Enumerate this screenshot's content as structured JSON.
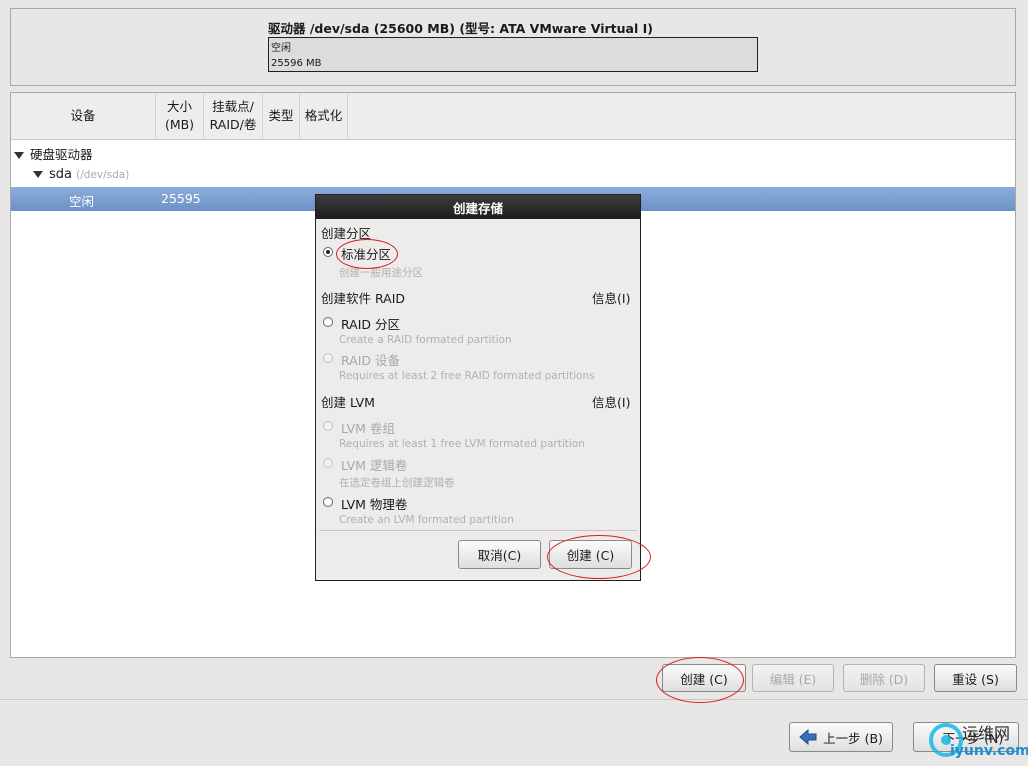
{
  "drive": {
    "title": "驱动器 /dev/sda (25600 MB) (型号: ATA VMware Virtual I)",
    "free_label": "空闲",
    "free_size": "25596 MB"
  },
  "table": {
    "columns": [
      "设备",
      "大小\n(MB)",
      "挂载点/\nRAID/卷",
      "类型",
      "格式化"
    ],
    "group_label": "硬盘驱动器",
    "disk_name": "sda",
    "disk_path": "(/dev/sda)",
    "free_row": {
      "device": "空闲",
      "size": "25595"
    }
  },
  "dialog": {
    "title": "创建存储",
    "section_partition": "创建分区",
    "standard_partition": "标准分区",
    "standard_partition_hint": "创建一般用途分区",
    "section_raid": "创建软件 RAID",
    "info_link": "信息(I)",
    "raid_partition": "RAID 分区",
    "raid_partition_hint": "Create a RAID formated partition",
    "raid_device": "RAID 设备",
    "raid_device_hint": "Requires at least 2 free RAID formated partitions",
    "section_lvm": "创建 LVM",
    "lvm_vg": "LVM 卷组",
    "lvm_vg_hint": "Requires at least 1 free LVM formated partition",
    "lvm_lv": "LVM 逻辑卷",
    "lvm_lv_hint": "在选定卷组上创建逻辑卷",
    "lvm_pv": "LVM 物理卷",
    "lvm_pv_hint": "Create an LVM formated partition",
    "cancel": "取消(C)",
    "create": "创建 (C)"
  },
  "toolbar": {
    "create": "创建 (C)",
    "edit": "编辑 (E)",
    "delete": "删除 (D)",
    "reset": "重设 (S)"
  },
  "nav": {
    "back": "上一步 (B)",
    "next": "下一步 (N)"
  },
  "watermark": {
    "line1": "运维网",
    "line2": "iyunv.com"
  },
  "colors": {
    "selection": "#7a9dd0",
    "annotation": "#d61f1f",
    "dialog_title": "#262626"
  }
}
